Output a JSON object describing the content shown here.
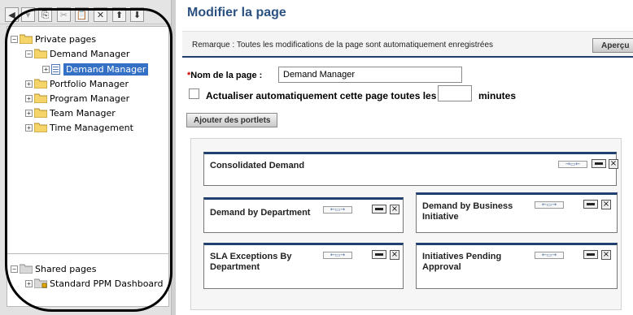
{
  "toolbar": {
    "icons": [
      "back-arrow-icon",
      "forward-arrow-icon",
      "copy-icon",
      "cut-icon",
      "paste-icon",
      "delete-icon",
      "move-up-icon",
      "move-down-icon"
    ],
    "glyphs": [
      "◀",
      "▾",
      "⎘",
      "✂",
      "📋",
      "✕",
      "⬆",
      "⬇"
    ]
  },
  "tree": {
    "private_pages": "Private pages",
    "demand_manager_folder": "Demand Manager",
    "demand_manager_page": "Demand Manager",
    "portfolio_manager": "Portfolio Manager",
    "program_manager": "Program Manager",
    "team_manager": "Team Manager",
    "time_management": "Time Management",
    "shared_pages": "Shared pages",
    "standard_ppm_dashboard": "Standard PPM Dashboard",
    "expand_glyph": "+",
    "collapse_glyph": "−"
  },
  "main": {
    "title": "Modifier la page",
    "remark": "Remarque : Toutes les modifications de la page sont automatiquement enregistrées",
    "preview_button": "Aperçu",
    "name_required_mark": "*",
    "name_label": "Nom de la page :",
    "name_value": "Demand Manager",
    "auto_refresh_label": "Actualiser automatiquement cette page toutes les",
    "minutes_label": "minutes",
    "add_portlets_button": "Ajouter des portlets"
  },
  "portlets": {
    "consolidated_demand": "Consolidated Demand",
    "demand_by_department": "Demand by Department",
    "demand_by_business_initiative": "Demand by Business Initiative",
    "sla_exceptions_by_department": "SLA Exceptions By Department",
    "initiatives_pending_approval": "Initiatives Pending Approval",
    "width_glyph_wide": "→▭←",
    "width_glyph_narrow": "←▭→",
    "close_glyph": "×"
  },
  "colors": {
    "title_blue": "#2b5181",
    "portlet_border": "#20406f",
    "selection_blue": "#3470c5",
    "folder_yellow": "#f5d56a",
    "required_red": "#cc0000"
  }
}
